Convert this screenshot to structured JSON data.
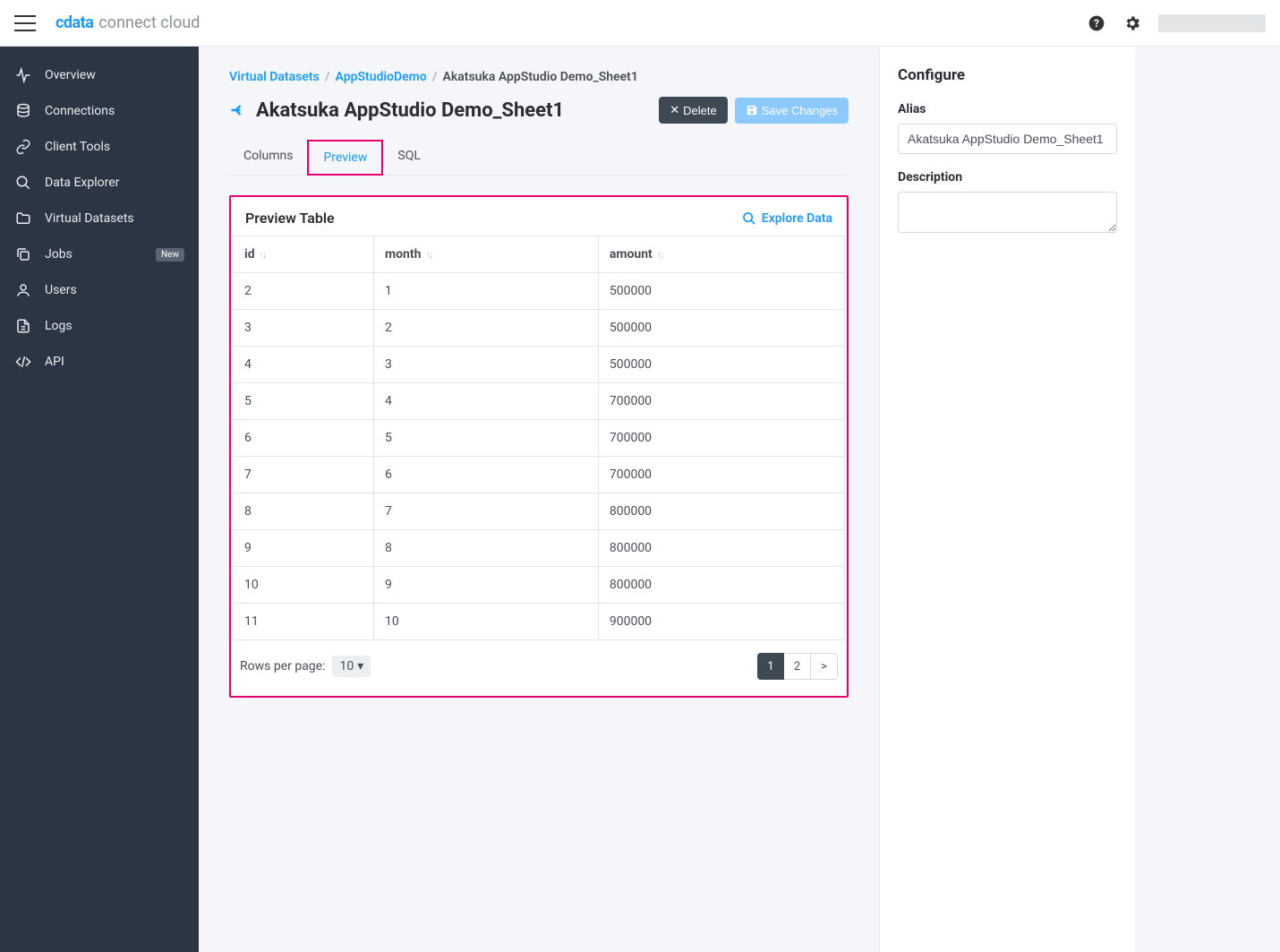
{
  "brand": {
    "primary": "cdata",
    "secondary": "connect cloud"
  },
  "sidebar": {
    "items": [
      {
        "label": "Overview",
        "icon": "pulse"
      },
      {
        "label": "Connections",
        "icon": "database"
      },
      {
        "label": "Client Tools",
        "icon": "link"
      },
      {
        "label": "Data Explorer",
        "icon": "search"
      },
      {
        "label": "Virtual Datasets",
        "icon": "folder"
      },
      {
        "label": "Jobs",
        "icon": "copy",
        "badge": "New"
      },
      {
        "label": "Users",
        "icon": "user"
      },
      {
        "label": "Logs",
        "icon": "file"
      },
      {
        "label": "API",
        "icon": "code"
      }
    ]
  },
  "breadcrumb": {
    "items": [
      {
        "text": "Virtual Datasets",
        "link": true
      },
      {
        "text": "AppStudioDemo",
        "link": true
      },
      {
        "text": "Akatsuka AppStudio Demo_Sheet1",
        "link": false
      }
    ]
  },
  "page": {
    "title": "Akatsuka AppStudio Demo_Sheet1",
    "delete_label": "Delete",
    "save_label": "Save Changes"
  },
  "tabs": [
    {
      "label": "Columns",
      "active": false
    },
    {
      "label": "Preview",
      "active": true
    },
    {
      "label": "SQL",
      "active": false
    }
  ],
  "preview": {
    "title": "Preview Table",
    "explore_label": "Explore Data",
    "columns": [
      "id",
      "month",
      "amount"
    ],
    "rows": [
      [
        "2",
        "1",
        "500000"
      ],
      [
        "3",
        "2",
        "500000"
      ],
      [
        "4",
        "3",
        "500000"
      ],
      [
        "5",
        "4",
        "700000"
      ],
      [
        "6",
        "5",
        "700000"
      ],
      [
        "7",
        "6",
        "700000"
      ],
      [
        "8",
        "7",
        "800000"
      ],
      [
        "9",
        "8",
        "800000"
      ],
      [
        "10",
        "9",
        "800000"
      ],
      [
        "11",
        "10",
        "900000"
      ]
    ],
    "rows_per_page_label": "Rows per page:",
    "rows_per_page_value": "10",
    "pages": [
      "1",
      "2"
    ],
    "current_page": "1",
    "next_label": ">"
  },
  "configure": {
    "title": "Configure",
    "alias_label": "Alias",
    "alias_value": "Akatsuka AppStudio Demo_Sheet1",
    "description_label": "Description",
    "description_value": ""
  }
}
